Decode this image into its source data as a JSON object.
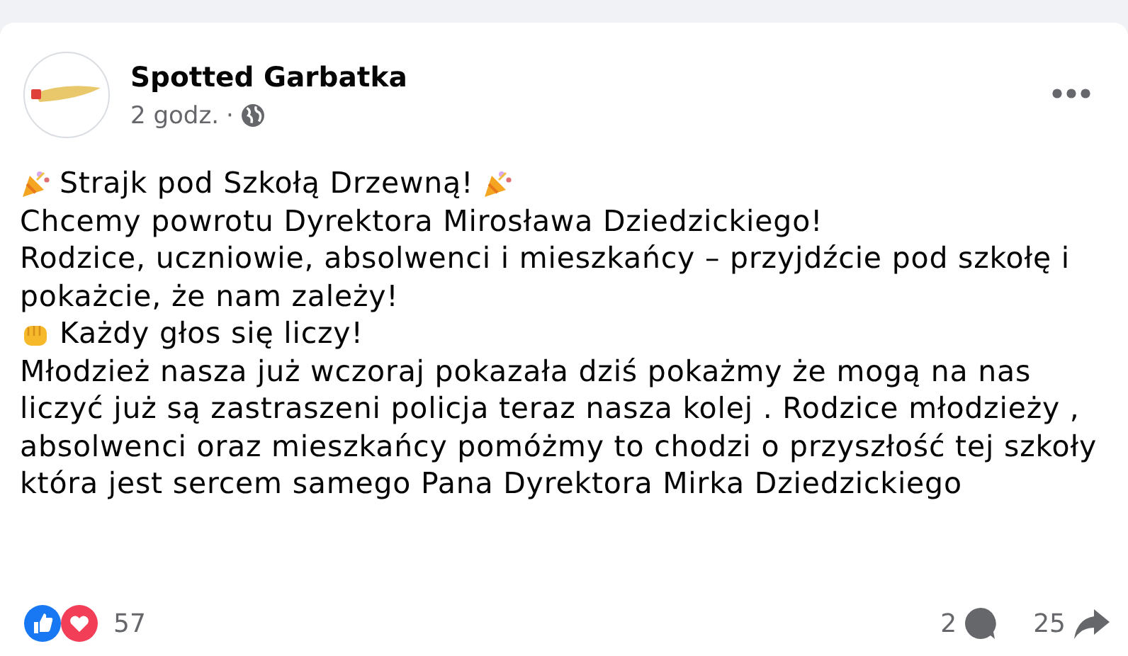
{
  "post": {
    "author": "Spotted Garbatka",
    "time": "2 godz.",
    "separator": "·",
    "paragraphs": [
      {
        "lines": [
          "Strajk pod Szkołą Drzewną!"
        ],
        "kind": "party"
      },
      {
        "lines": [
          "Chcemy powrotu Dyrektora Mirosława Dziedzickiego!"
        ]
      },
      {
        "lines": [
          "Rodzice, uczniowie, absolwenci i mieszkańcy – przyjdźcie pod szkołę i",
          "pokażcie, że nam zależy!"
        ]
      },
      {
        "lines": [
          "Każdy głos się liczy!"
        ],
        "kind": "fist"
      },
      {
        "lines": [
          "Młodzież nasza już wczoraj pokazała dziś pokażmy że mogą na nas",
          "liczyć  już są zastraszeni policja teraz nasza kolej . Rodzice młodzieży ,",
          "absolwenci oraz mieszkańcy pomóżmy to chodzi o przyszłość tej szkoły",
          "która jest sercem samego Pana Dyrektora Mirka Dziedzickiego"
        ]
      }
    ],
    "reactions_count": "57",
    "comments_count": "2",
    "shares_count": "25"
  }
}
